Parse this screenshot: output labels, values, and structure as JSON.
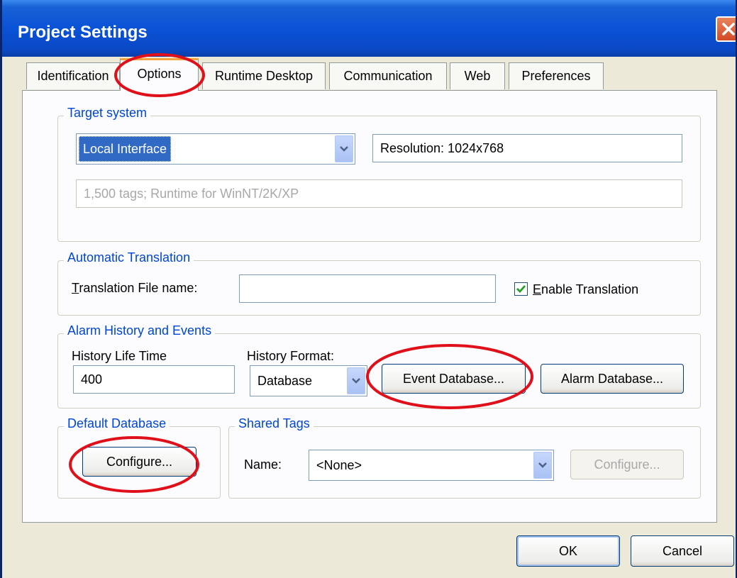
{
  "window": {
    "title": "Project Settings"
  },
  "tabs": [
    {
      "label": "Identification"
    },
    {
      "label": "Options"
    },
    {
      "label": "Runtime Desktop"
    },
    {
      "label": "Communication"
    },
    {
      "label": "Web"
    },
    {
      "label": "Preferences"
    }
  ],
  "active_tab": "Options",
  "target_system": {
    "legend": "Target system",
    "platform_value": "Local Interface",
    "resolution": "Resolution: 1024x768",
    "description": "1,500 tags; Runtime for WinNT/2K/XP"
  },
  "automatic_translation": {
    "legend": "Automatic Translation",
    "file_label_underlined": "T",
    "file_label_rest": "ranslation File name:",
    "file_value": "",
    "enable_checked": true,
    "enable_label_underlined": "E",
    "enable_label_rest": "nable Translation"
  },
  "alarm_history": {
    "legend": "Alarm History and Events",
    "life_time_label": "History Life Time",
    "life_time_value": "400",
    "format_label": "History Format:",
    "format_value": "Database",
    "event_db_button": "Event Database...",
    "alarm_db_button": "Alarm Database..."
  },
  "default_database": {
    "legend": "Default Database",
    "configure_button": "Configure..."
  },
  "shared_tags": {
    "legend": "Shared Tags",
    "name_label": "Name:",
    "name_value": "<None>",
    "configure_button": "Configure..."
  },
  "footer": {
    "ok_button": "OK",
    "cancel_button": "Cancel"
  },
  "colors": {
    "titlebar": "#0a52d6",
    "legend_text": "#0046d5",
    "selection": "#316ac5",
    "annotation": "#e0101a"
  }
}
